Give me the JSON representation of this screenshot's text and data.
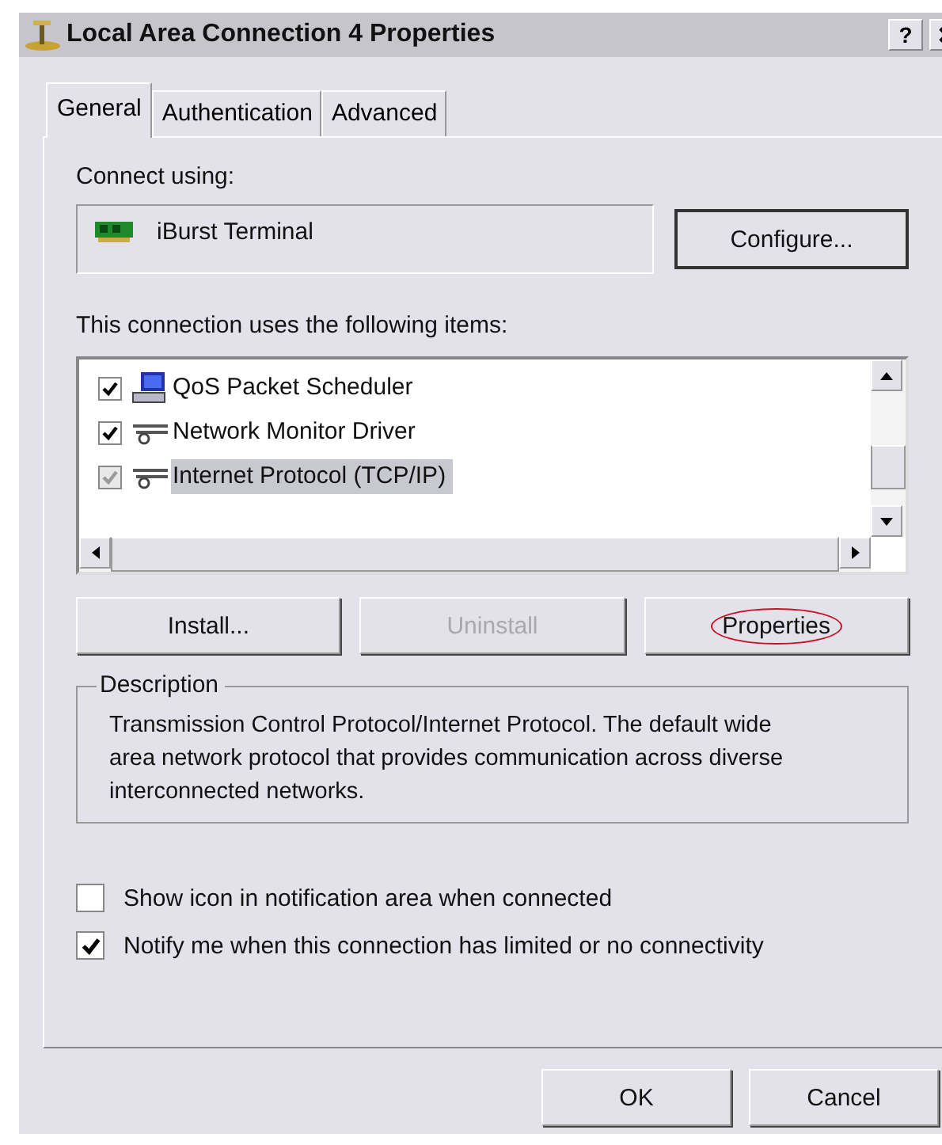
{
  "window": {
    "title": "Local Area Connection 4 Properties",
    "help_label": "?"
  },
  "tabs": [
    {
      "label": "General",
      "selected": true
    },
    {
      "label": "Authentication",
      "selected": false
    },
    {
      "label": "Advanced",
      "selected": false
    }
  ],
  "connect_using": {
    "label": "Connect using:",
    "adapter": "iBurst Terminal",
    "button": "Configure..."
  },
  "items_label": "This connection uses the following items:",
  "items": [
    {
      "label": "QoS Packet Scheduler",
      "kind": "service",
      "checked": true,
      "disabled": false,
      "selected": false
    },
    {
      "label": "Network Monitor Driver",
      "kind": "protocol",
      "checked": true,
      "disabled": false,
      "selected": false
    },
    {
      "label": "Internet Protocol (TCP/IP)",
      "kind": "protocol",
      "checked": true,
      "disabled": true,
      "selected": true
    }
  ],
  "item_buttons": [
    {
      "label": "Install...",
      "disabled": false,
      "circled": false
    },
    {
      "label": "Uninstall",
      "disabled": true,
      "circled": false
    },
    {
      "label": "Properties",
      "disabled": false,
      "circled": true
    }
  ],
  "description": {
    "title": "Description",
    "text": "Transmission Control Protocol/Internet Protocol. The default wide area network protocol that provides communication across diverse interconnected networks."
  },
  "options": [
    {
      "label": "Show icon in notification area when connected",
      "checked": false
    },
    {
      "label": "Notify me when this connection has limited or no connectivity",
      "checked": true
    }
  ],
  "buttons": [
    "OK",
    "Cancel"
  ]
}
